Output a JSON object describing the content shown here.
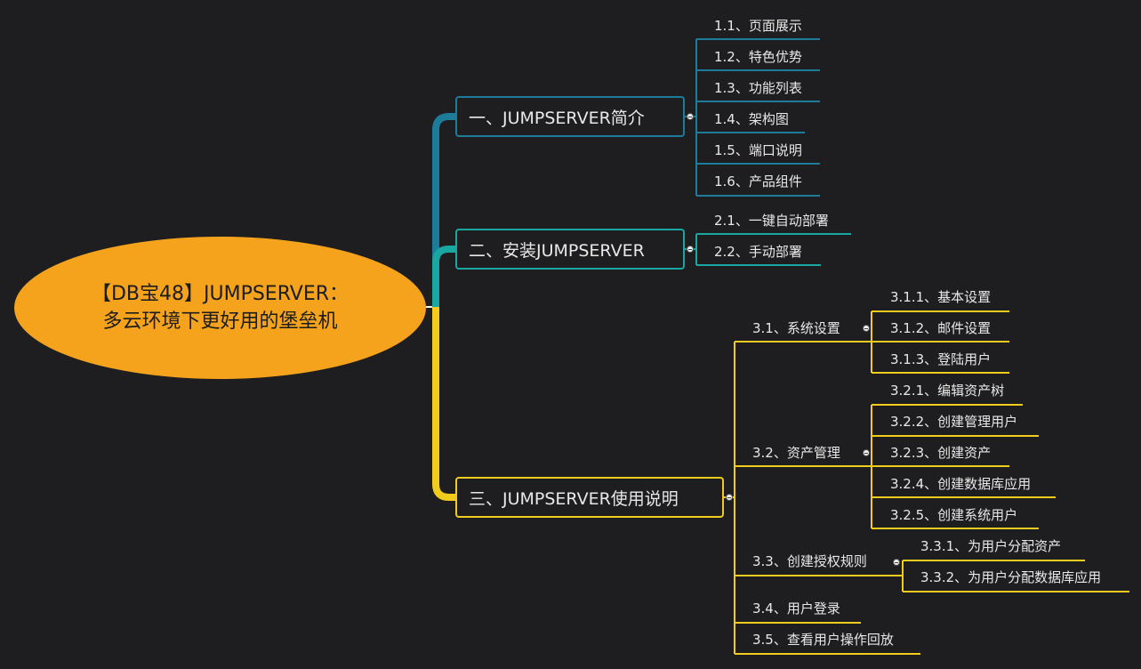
{
  "root": {
    "line1": "【DB宝48】JUMPSERVER：",
    "line2": "多云环境下更好用的堡垒机"
  },
  "branches": [
    {
      "label": "一、JUMPSERVER简介",
      "children": [
        "1.1、页面展示",
        "1.2、特色优势",
        "1.3、功能列表",
        "1.4、架构图",
        "1.5、端口说明",
        "1.6、产品组件"
      ]
    },
    {
      "label": "二、安装JUMPSERVER",
      "children": [
        "2.1、一键自动部署",
        "2.2、手动部署"
      ]
    },
    {
      "label": "三、JUMPSERVER使用说明",
      "children": [
        {
          "label": "3.1、系统设置",
          "children": [
            "3.1.1、基本设置",
            "3.1.2、邮件设置",
            "3.1.3、登陆用户"
          ]
        },
        {
          "label": "3.2、资产管理",
          "children": [
            "3.2.1、编辑资产树",
            "3.2.2、创建管理用户",
            "3.2.3、创建资产",
            "3.2.4、创建数据库应用",
            "3.2.5、创建系统用户"
          ]
        },
        {
          "label": "3.3、创建授权规则",
          "children": [
            "3.3.1、为用户分配资产",
            "3.3.2、为用户分配数据库应用"
          ]
        },
        {
          "label": "3.4、用户登录",
          "children": []
        },
        {
          "label": "3.5、查看用户操作回放",
          "children": []
        }
      ]
    }
  ],
  "colors": {
    "branch1": "#1c7c9a",
    "branch2": "#1aa7a1",
    "branch3": "#f2cc1c",
    "root": "#f5a31c",
    "background": "#1e1e20"
  }
}
